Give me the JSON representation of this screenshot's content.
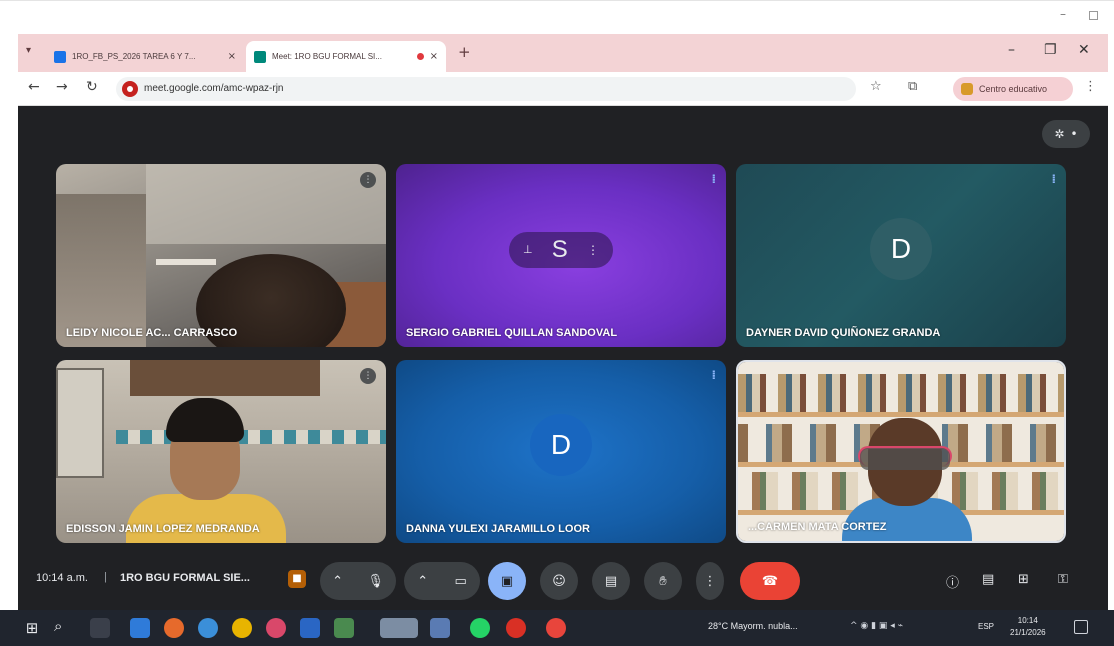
{
  "browser": {
    "tabs": [
      {
        "title": "1RO_FB_PS_2026 TAREA 6 Y 7...",
        "favicon_color": "#1a73e8"
      },
      {
        "title": "Meet: 1RO BGU FORMAL SI...",
        "favicon_color": "#00897b"
      }
    ],
    "url": "meet.google.com/amc-wpaz-rjn",
    "profile_label": "Centro educativo"
  },
  "meet": {
    "participants": [
      {
        "name": "LEIDY NICOLE AC... CARRASCO"
      },
      {
        "name": "SERGIO GABRIEL QUILLAN SANDOVAL",
        "initial": "S"
      },
      {
        "name": "DAYNER DAVID QUIÑONEZ GRANDA",
        "initial": "D"
      },
      {
        "name": "EDISSON JAMIN LOPEZ MEDRANDA"
      },
      {
        "name": "DANNA YULEXI JARAMILLO LOOR",
        "initial": "D"
      },
      {
        "name": "...CARMEN MATA CORTEZ"
      }
    ],
    "toolbar": {
      "time": "10:14 a.m.",
      "separator": "|",
      "meeting_title": "1RO BGU FORMAL SIE...",
      "icons": [
        "chevron-up-icon",
        "mic-icon",
        "camera-icon",
        "captions-icon",
        "emoji-icon",
        "present-icon",
        "raise-hand-icon",
        "more-options-icon",
        "hang-up-icon",
        "info-icon",
        "chat-icon",
        "activities-icon",
        "host-controls-icon"
      ]
    }
  },
  "taskbar": {
    "weather": "28°C  Mayorm. nubla...",
    "language": "ESP",
    "clock_time": "10:14",
    "clock_date": "21/1/2026"
  }
}
